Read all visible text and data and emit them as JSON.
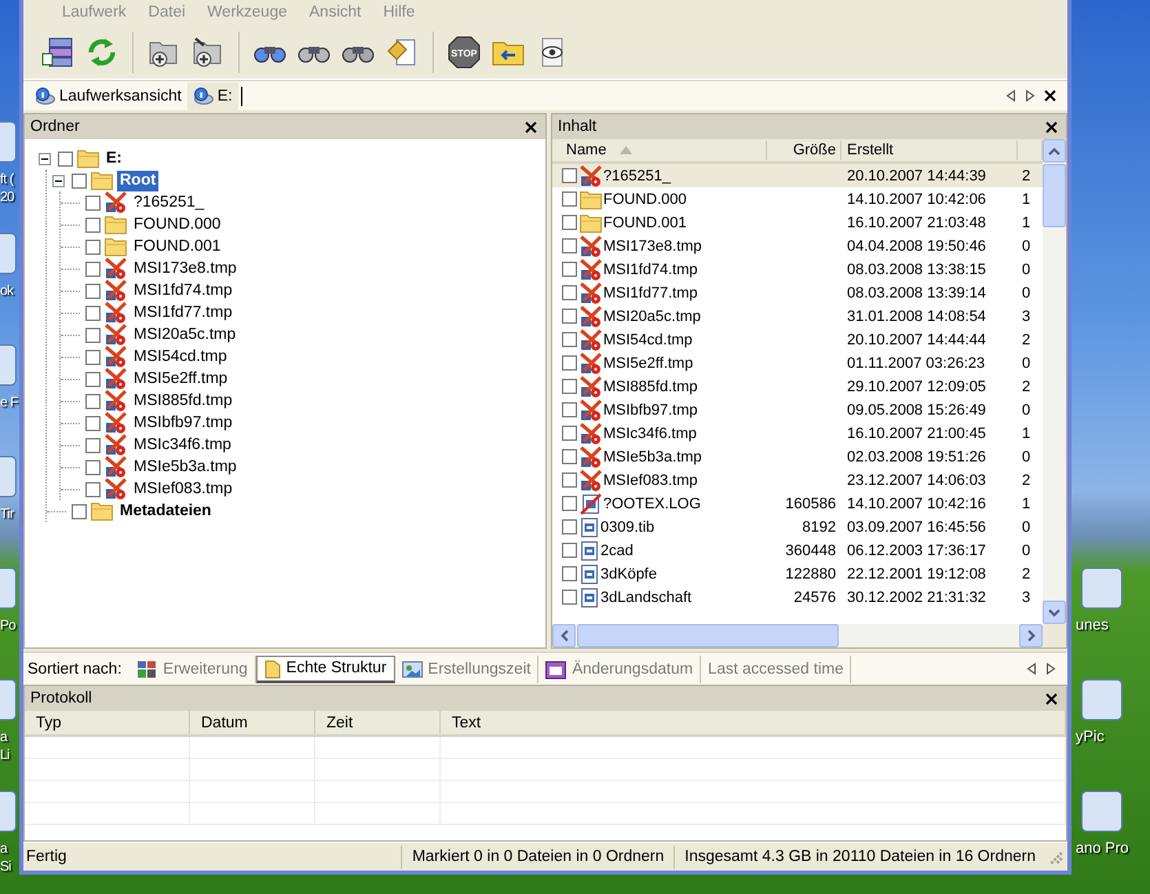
{
  "menu": [
    "Laufwerk",
    "Datei",
    "Werkzeuge",
    "Ansicht",
    "Hilfe"
  ],
  "toolbar": {
    "stop_sign": "STOP"
  },
  "address_tabs": [
    {
      "label": "Laufwerksansicht",
      "selected": false
    },
    {
      "label": "E:",
      "selected": true
    }
  ],
  "folder_panel": {
    "title": "Ordner",
    "tree": [
      {
        "label": "E:",
        "kind": "folder",
        "checked": false,
        "expanded": true,
        "selected": false,
        "children": [
          {
            "label": "Root",
            "kind": "folder",
            "checked": false,
            "expanded": true,
            "selected": true,
            "children": [
              {
                "label": "?165251_",
                "kind": "lost",
                "checked": false,
                "selected": false
              },
              {
                "label": "FOUND.000",
                "kind": "folder",
                "checked": false,
                "selected": false
              },
              {
                "label": "FOUND.001",
                "kind": "folder",
                "checked": false,
                "selected": false
              },
              {
                "label": "MSI173e8.tmp",
                "kind": "lost",
                "checked": false,
                "selected": false
              },
              {
                "label": "MSI1fd74.tmp",
                "kind": "lost",
                "checked": false,
                "selected": false
              },
              {
                "label": "MSI1fd77.tmp",
                "kind": "lost",
                "checked": false,
                "selected": false
              },
              {
                "label": "MSI20a5c.tmp",
                "kind": "lost",
                "checked": false,
                "selected": false
              },
              {
                "label": "MSI54cd.tmp",
                "kind": "lost",
                "checked": false,
                "selected": false
              },
              {
                "label": "MSI5e2ff.tmp",
                "kind": "lost",
                "checked": false,
                "selected": false
              },
              {
                "label": "MSI885fd.tmp",
                "kind": "lost",
                "checked": false,
                "selected": false
              },
              {
                "label": "MSIbfb97.tmp",
                "kind": "lost",
                "checked": false,
                "selected": false
              },
              {
                "label": "MSIc34f6.tmp",
                "kind": "lost",
                "checked": false,
                "selected": false
              },
              {
                "label": "MSIe5b3a.tmp",
                "kind": "lost",
                "checked": false,
                "selected": false
              },
              {
                "label": "MSIef083.tmp",
                "kind": "lost",
                "checked": false,
                "selected": false
              }
            ]
          },
          {
            "label": "Metadateien",
            "kind": "folder",
            "checked": false,
            "selected": false
          }
        ]
      }
    ]
  },
  "content_panel": {
    "title": "Inhalt",
    "columns": [
      "Name",
      "Größe",
      "Erstellt"
    ],
    "rows": [
      {
        "name": "?165251_",
        "kind": "lost",
        "created": "20.10.2007 14:44:39",
        "column_4": "2",
        "checked": false,
        "selected": true
      },
      {
        "name": "FOUND.000",
        "kind": "folder",
        "created": "14.10.2007 10:42:06",
        "column_4": "1",
        "checked": false,
        "selected": false
      },
      {
        "name": "FOUND.001",
        "kind": "folder",
        "created": "16.10.2007 21:03:48",
        "column_4": "1",
        "checked": false,
        "selected": false
      },
      {
        "name": "MSI173e8.tmp",
        "kind": "lost",
        "created": "04.04.2008 19:50:46",
        "column_4": "0",
        "checked": false,
        "selected": false
      },
      {
        "name": "MSI1fd74.tmp",
        "kind": "lost",
        "created": "08.03.2008 13:38:15",
        "column_4": "0",
        "checked": false,
        "selected": false
      },
      {
        "name": "MSI1fd77.tmp",
        "kind": "lost",
        "created": "08.03.2008 13:39:14",
        "column_4": "0",
        "checked": false,
        "selected": false
      },
      {
        "name": "MSI20a5c.tmp",
        "kind": "lost",
        "created": "31.01.2008 14:08:54",
        "column_4": "3",
        "checked": false,
        "selected": false
      },
      {
        "name": "MSI54cd.tmp",
        "kind": "lost",
        "created": "20.10.2007 14:44:44",
        "column_4": "2",
        "checked": false,
        "selected": false
      },
      {
        "name": "MSI5e2ff.tmp",
        "kind": "lost",
        "created": "01.11.2007 03:26:23",
        "column_4": "0",
        "checked": false,
        "selected": false
      },
      {
        "name": "MSI885fd.tmp",
        "kind": "lost",
        "created": "29.10.2007 12:09:05",
        "column_4": "2",
        "checked": false,
        "selected": false
      },
      {
        "name": "MSIbfb97.tmp",
        "kind": "lost",
        "created": "09.05.2008 15:26:49",
        "column_4": "0",
        "checked": false,
        "selected": false
      },
      {
        "name": "MSIc34f6.tmp",
        "kind": "lost",
        "created": "16.10.2007 21:00:45",
        "column_4": "1",
        "checked": false,
        "selected": false
      },
      {
        "name": "MSIe5b3a.tmp",
        "kind": "lost",
        "created": "02.03.2008 19:51:26",
        "column_4": "0",
        "checked": false,
        "selected": false
      },
      {
        "name": "MSIef083.tmp",
        "kind": "lost",
        "created": "23.12.2007 14:06:03",
        "column_4": "2",
        "checked": false,
        "selected": false
      },
      {
        "name": "?OOTEX.LOG",
        "kind": "damaged",
        "size": "160586",
        "created": "14.10.2007 10:42:16",
        "column_4": "1",
        "checked": false,
        "selected": false
      },
      {
        "name": "0309.tib",
        "kind": "file",
        "size": "8192",
        "created": "03.09.2007 16:45:56",
        "column_4": "0",
        "checked": false,
        "selected": false
      },
      {
        "name": "2cad",
        "kind": "file",
        "size": "360448",
        "created": "06.12.2003 17:36:17",
        "column_4": "0",
        "checked": false,
        "selected": false
      },
      {
        "name": "3dKöpfe",
        "kind": "file",
        "size": "122880",
        "created": "22.12.2001 19:12:08",
        "column_4": "2",
        "checked": false,
        "selected": false
      },
      {
        "name": "3dLandschaft",
        "kind": "file",
        "size": "24576",
        "created": "30.12.2002 21:31:32",
        "column_4": "3",
        "checked": false,
        "selected": false
      }
    ]
  },
  "sort_bar": {
    "label": "Sortiert nach:",
    "tabs": [
      {
        "label": "Erweiterung",
        "kind": "extension",
        "selected": false
      },
      {
        "label": "Echte Struktur",
        "kind": "structure",
        "selected": true
      },
      {
        "label": "Erstellungszeit",
        "kind": "created",
        "selected": false
      },
      {
        "label": "Änderungsdatum",
        "kind": "modified",
        "selected": false
      },
      {
        "label": "Last accessed time",
        "kind": "accessed",
        "selected": false
      }
    ]
  },
  "log_panel": {
    "title": "Protokoll",
    "columns": [
      "Typ",
      "Datum",
      "Zeit",
      "Text"
    ]
  },
  "status_bar": [
    "Fertig",
    "Markiert 0 in 0 Dateien in 0 Ordnern",
    "Insgesamt 4.3 GB in 20110 Dateien in 16 Ordnern"
  ],
  "desktop": {
    "left_icons": [
      {
        "lines": [
          "ft (",
          "20"
        ]
      },
      {
        "lines": [
          "ok"
        ]
      },
      {
        "lines": [
          "e F"
        ]
      },
      {
        "lines": [
          "Tir"
        ]
      },
      {
        "lines": [
          "Po"
        ]
      },
      {
        "lines": [
          "a Li"
        ]
      },
      {
        "lines": [
          "a Si"
        ]
      }
    ],
    "right_icons": [
      {
        "label": "unes"
      },
      {
        "label": "yPic"
      },
      {
        "label": "ano Pro"
      }
    ]
  }
}
